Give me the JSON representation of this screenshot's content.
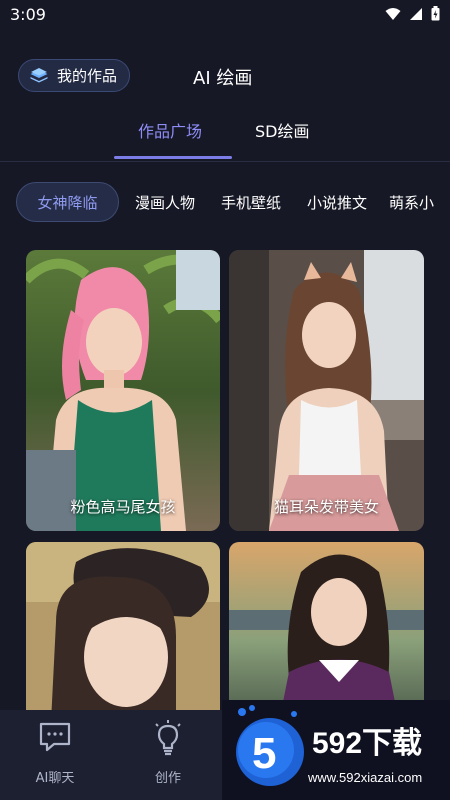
{
  "status": {
    "time": "3:09"
  },
  "header": {
    "works_label": "我的作品",
    "title": "AI 绘画"
  },
  "tabs": [
    {
      "label": "作品广场"
    },
    {
      "label": "SD绘画"
    }
  ],
  "categories": [
    "女神降临",
    "漫画人物",
    "手机壁纸",
    "小说推文",
    "萌系小"
  ],
  "gallery": [
    {
      "caption": "粉色高马尾女孩"
    },
    {
      "caption": "猫耳朵发带美女"
    },
    {
      "caption": ""
    },
    {
      "caption": ""
    }
  ],
  "bottom_nav": [
    {
      "label": "AI聊天"
    },
    {
      "label": "创作"
    }
  ],
  "watermark": {
    "brand": "592下载",
    "url": "www.592xiazai.com"
  },
  "colors": {
    "background": "#161826",
    "accent": "#8e8df5",
    "nav_bg": "#1d2030"
  }
}
